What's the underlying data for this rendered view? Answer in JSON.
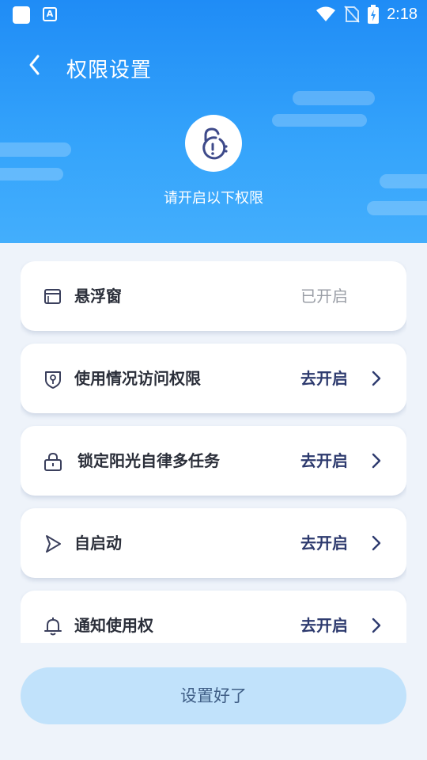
{
  "status_bar": {
    "time": "2:18"
  },
  "header": {
    "title": "权限设置",
    "subtitle": "请开启以下权限"
  },
  "permissions": [
    {
      "label": "悬浮窗",
      "status": "已开启",
      "icon": "window-icon"
    },
    {
      "label": "使用情况访问权限",
      "status": "去开启",
      "icon": "shield-key-icon"
    },
    {
      "label": "锁定阳光自律多任务",
      "status": "去开启",
      "icon": "lock-icon"
    },
    {
      "label": "自启动",
      "status": "去开启",
      "icon": "play-icon"
    },
    {
      "label": "通知使用权",
      "status": "去开启",
      "icon": "bell-icon"
    }
  ],
  "footer": {
    "button_label": "设置好了"
  },
  "colors": {
    "header_blue": "#1f8cf6",
    "action_text": "#2d3a6e",
    "done_text": "#9a9ea6",
    "button_bg": "#c1e2fb"
  }
}
